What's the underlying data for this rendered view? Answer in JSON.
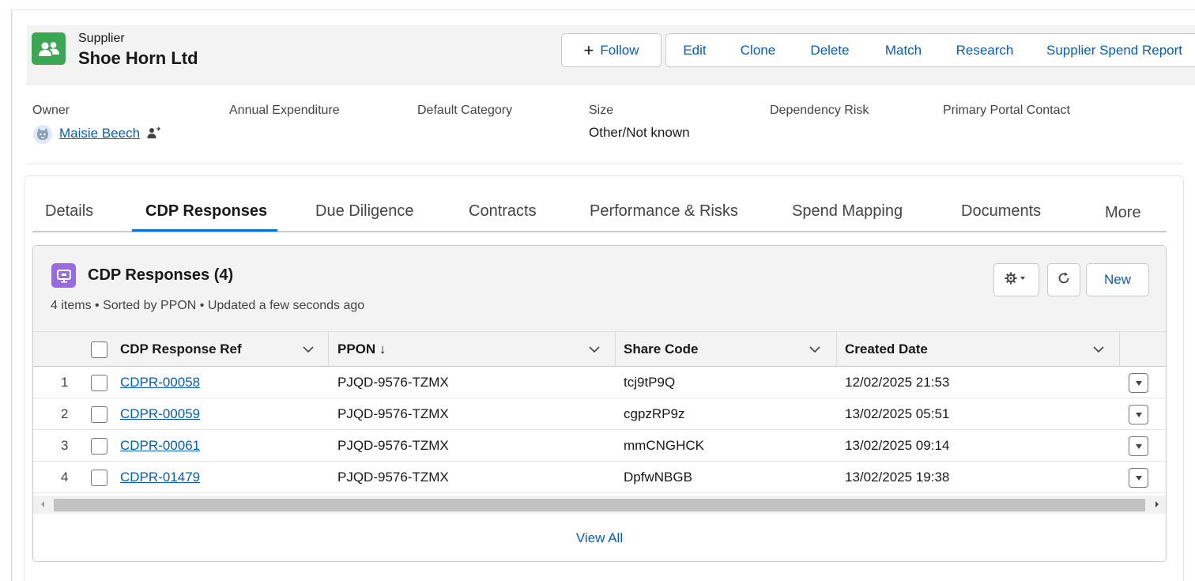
{
  "record": {
    "object_type": "Supplier",
    "name": "Shoe Horn Ltd",
    "icon": "supplier-people-icon",
    "icon_color": "#3ba755"
  },
  "actions": {
    "follow": "Follow",
    "buttons": [
      "Edit",
      "Clone",
      "Delete",
      "Match",
      "Research",
      "Supplier Spend Report"
    ]
  },
  "highlights": {
    "owner_label": "Owner",
    "owner_value": "Maisie Beech",
    "annual_expenditure_label": "Annual Expenditure",
    "default_category_label": "Default Category",
    "size_label": "Size",
    "size_value": "Other/Not known",
    "dependency_risk_label": "Dependency Risk",
    "primary_portal_contact_label": "Primary Portal Contact"
  },
  "tabs": [
    {
      "label": "Details",
      "active": false
    },
    {
      "label": "CDP Responses",
      "active": true
    },
    {
      "label": "Due Diligence",
      "active": false
    },
    {
      "label": "Contracts",
      "active": false
    },
    {
      "label": "Performance & Risks",
      "active": false
    },
    {
      "label": "Spend Mapping",
      "active": false
    },
    {
      "label": "Documents",
      "active": false
    },
    {
      "label": "More",
      "active": false
    }
  ],
  "related_list": {
    "title": "CDP Responses (4)",
    "meta": "4 items • Sorted by PPON • Updated a few seconds ago",
    "icon_color": "#9a6be0",
    "new_label": "New",
    "columns": [
      "CDP Response Ref",
      "PPON ↓",
      "Share Code",
      "Created Date"
    ],
    "rows": [
      {
        "num": "1",
        "ref": "CDPR-00058",
        "ppon": "PJQD-9576-TZMX",
        "share_code": "tcj9tP9Q",
        "created": "12/02/2025 21:53"
      },
      {
        "num": "2",
        "ref": "CDPR-00059",
        "ppon": "PJQD-9576-TZMX",
        "share_code": "cgpzRP9z",
        "created": "13/02/2025 05:51"
      },
      {
        "num": "3",
        "ref": "CDPR-00061",
        "ppon": "PJQD-9576-TZMX",
        "share_code": "mmCNGHCK",
        "created": "13/02/2025 09:14"
      },
      {
        "num": "4",
        "ref": "CDPR-01479",
        "ppon": "PJQD-9576-TZMX",
        "share_code": "DpfwNBGB",
        "created": "13/02/2025 19:38"
      }
    ],
    "view_all": "View All"
  },
  "colors": {
    "brand_blue": "#0176d3",
    "link_blue": "#0b5cab"
  }
}
